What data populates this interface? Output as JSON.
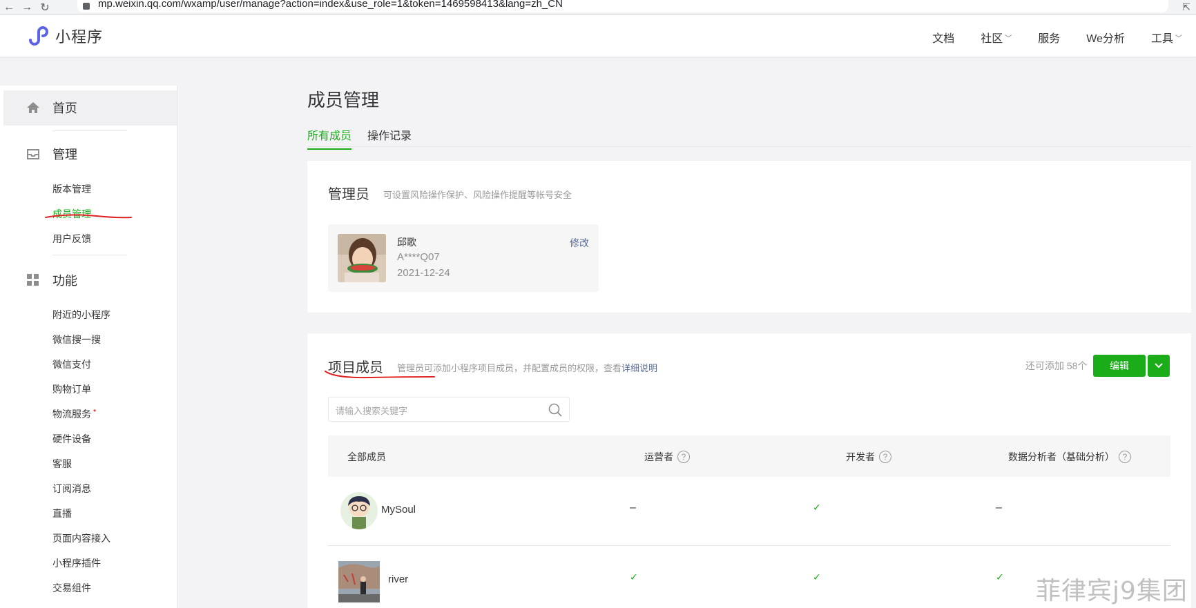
{
  "browser": {
    "url": "mp.weixin.qq.com/wxamp/user/manage?action=index&use_role=1&token=1469598413&lang=zh_CN"
  },
  "header": {
    "logo_text": "小程序",
    "nav": [
      {
        "label": "文档"
      },
      {
        "label": "社区",
        "dropdown": true
      },
      {
        "label": "服务"
      },
      {
        "label": "We分析"
      },
      {
        "label": "工具",
        "dropdown": true
      }
    ]
  },
  "sidebar": {
    "home_label": "首页",
    "manage_label": "管理",
    "manage_items": [
      "版本管理",
      "成员管理",
      "用户反馈"
    ],
    "active_item": "成员管理",
    "features_label": "功能",
    "feature_items": [
      "附近的小程序",
      "微信搜一搜",
      "微信支付",
      "购物订单",
      "物流服务",
      "硬件设备",
      "客服",
      "订阅消息",
      "直播",
      "页面内容接入",
      "小程序插件",
      "交易组件"
    ],
    "red_dot_item": "物流服务"
  },
  "main": {
    "title": "成员管理",
    "tabs": [
      {
        "label": "所有成员",
        "active": true
      },
      {
        "label": "操作记录",
        "active": false
      }
    ],
    "admin": {
      "title": "管理员",
      "desc": "可设置风险操作保护、风险操作提醒等帐号安全",
      "name": "邱歌",
      "account": "A****Q07",
      "date": "2021-12-24",
      "edit_label": "修改"
    },
    "members": {
      "title": "项目成员",
      "desc_prefix": "管理员可添加小程序项目成员，并配置成员的权限，查看",
      "desc_link": "详细说明",
      "remain": "还可添加 58个",
      "edit_button": "编辑",
      "search_placeholder": "请输入搜索关键字",
      "columns": [
        "全部成员",
        "运营者",
        "开发者",
        "数据分析者（基础分析）"
      ],
      "rows": [
        {
          "name": "MySoul",
          "operator": "–",
          "developer": "✓",
          "analyst": "–"
        },
        {
          "name": "river",
          "operator": "✓",
          "developer": "✓",
          "analyst": "✓"
        }
      ]
    }
  },
  "watermark": "菲律宾j9集团",
  "colors": {
    "accent": "#1aad19",
    "link": "#576b95",
    "annotation": "#e02020"
  }
}
